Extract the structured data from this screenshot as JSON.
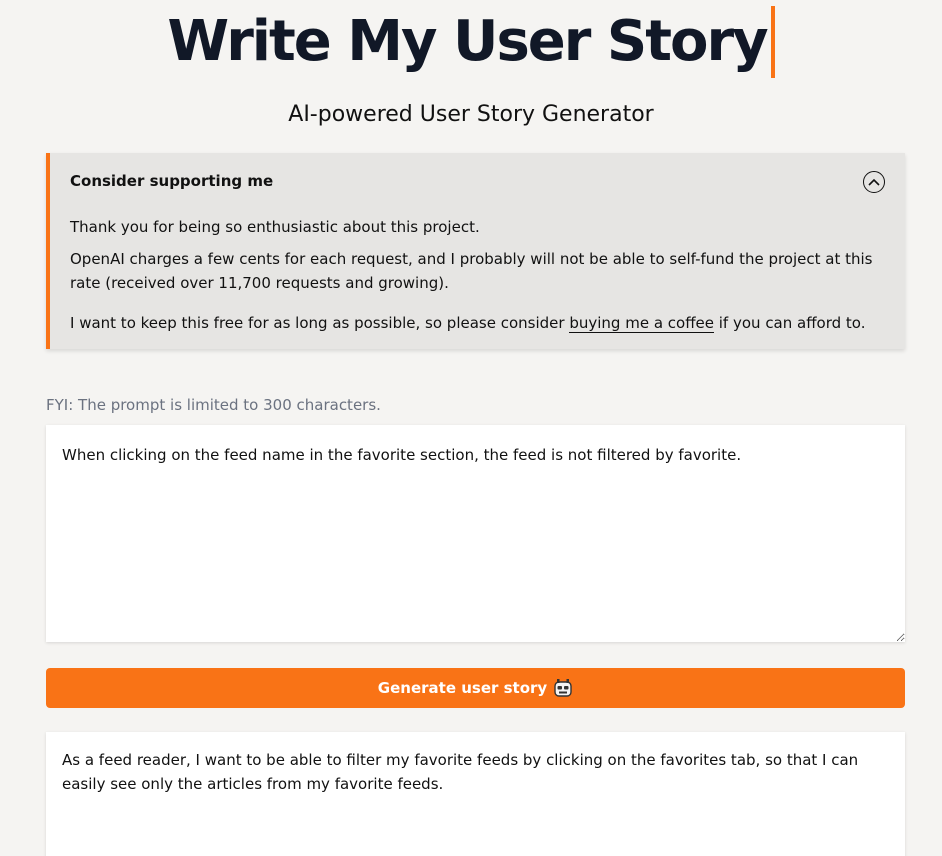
{
  "header": {
    "title": "Write My User Story",
    "subtitle": "AI-powered User Story Generator"
  },
  "support": {
    "title": "Consider supporting me",
    "toggle_icon": "chevron-up-circle-icon",
    "paragraph1": "Thank you for being so enthusiastic about this project.",
    "paragraph2": "OpenAI charges a few cents for each request, and I probably will not be able to self-fund the project at this rate (received over 11,700 requests and growing).",
    "paragraph3_before": "I want to keep this free for as long as possible, so please consider ",
    "coffee_link": "buying me a coffee",
    "paragraph3_after": " if you can afford to."
  },
  "prompt": {
    "notice": "FYI: The prompt is limited to 300 characters.",
    "value": "When clicking on the feed name in the favorite section, the feed is not filtered by favorite."
  },
  "generate": {
    "label": "Generate user story",
    "icon": "robot-icon"
  },
  "result": {
    "text": "As a feed reader, I want to be able to filter my favorite feeds by clicking on the favorites tab, so that I can easily see only the articles from my favorite feeds."
  },
  "colors": {
    "accent": "#f97316",
    "background": "#f5f4f2",
    "panel": "#e6e5e3",
    "title": "#111827",
    "muted": "#6b7280"
  }
}
